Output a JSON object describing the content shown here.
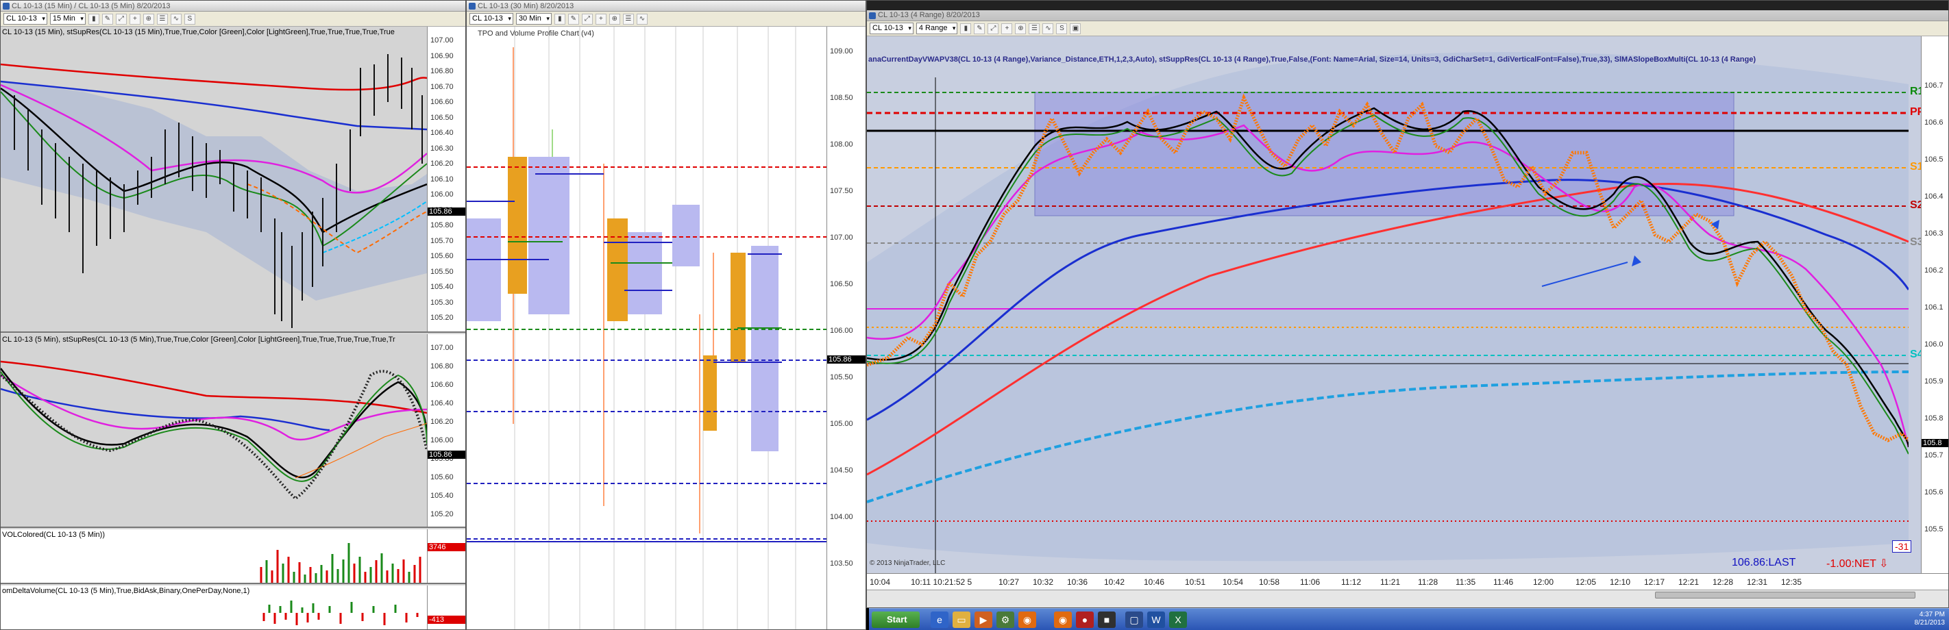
{
  "left_window": {
    "title": "CL 10-13 (15 Min) / CL 10-13 (5 Min)  8/20/2013",
    "instrument": "CL 10-13",
    "interval": "15 Min",
    "panel1_label": "CL 10-13 (15 Min), stSupRes(CL 10-13 (15 Min),True,True,Color [Green],Color [LightGreen],True,True,True,True,True",
    "panel1_ticks": [
      "107.00",
      "106.90",
      "106.80",
      "106.70",
      "106.60",
      "106.50",
      "106.40",
      "106.30",
      "106.20",
      "106.10",
      "106.00",
      "105.90",
      "105.80",
      "105.70",
      "105.60",
      "105.50",
      "105.40",
      "105.30",
      "105.20"
    ],
    "panel1_last": "105.86",
    "panel2_label": "CL 10-13 (5 Min), stSupRes(CL 10-13 (5 Min),True,True,Color [Green],Color [LightGreen],True,True,True,True,True,Tr",
    "panel2_ticks": [
      "107.00",
      "106.80",
      "106.60",
      "106.40",
      "106.20",
      "106.00",
      "105.80",
      "105.60",
      "105.40",
      "105.20"
    ],
    "panel2_last": "105.86",
    "panel3_label": "VOLColored(CL 10-13 (5 Min))",
    "panel3_value": "3746",
    "panel4_label": "omDeltaVolume(CL 10-13 (5 Min),True,BidAsk,Binary,OnePerDay,None,1)",
    "panel4_value": "-413"
  },
  "middle_window": {
    "title": "CL 10-13 (30 Min)  8/20/2013",
    "instrument": "CL 10-13",
    "interval": "30 Min",
    "chart_label": "TPO and Volume Profile Chart (v4)",
    "ticks": [
      "109.00",
      "108.50",
      "108.00",
      "107.50",
      "107.00",
      "106.50",
      "106.00",
      "105.50",
      "105.00",
      "104.50",
      "104.00",
      "103.50"
    ],
    "last": "105.86"
  },
  "right_window": {
    "title": "CL 10-13 (4 Range)  8/20/2013",
    "instrument": "CL 10-13",
    "interval": "4 Range",
    "indicator_text": "anaCurrentDayVWAPV38(CL 10-13 (4 Range),Variance_Distance,ETH,1,2,3,Auto), stSuppRes(CL 10-13 (4 Range),True,False,(Font: Name=Arial, Size=14, Units=3, GdiCharSet=1, GdiVerticalFont=False),True,33), SlMASlopeBoxMulti(CL 10-13 (4 Range)",
    "level_labels": [
      "R1",
      "PP",
      "S1",
      "S2",
      "S3",
      "S4"
    ],
    "ticks": [
      "106.7",
      "106.6",
      "106.5",
      "106.4",
      "106.3",
      "106.2",
      "106.1",
      "106.0",
      "105.9",
      "105.8",
      "105.7",
      "105.6",
      "105.5"
    ],
    "last": "105.8",
    "time_labels": [
      "10:04",
      "10:11 10:21:52 5",
      "10:27",
      "10:32",
      "10:36",
      "10:42",
      "10:46",
      "10:51",
      "10:54",
      "10:58",
      "11:06",
      "11:12",
      "11:21",
      "11:28",
      "11:35",
      "11:46",
      "12:00",
      "12:05",
      "12:10",
      "12:17",
      "12:21",
      "12:28",
      "12:31",
      "12:35"
    ],
    "copyright": "© 2013 NinjaTrader, LLC",
    "last_price_text": "106.86:LAST",
    "net_text": "-1.00:NET ⇩",
    "box_value": "-31"
  },
  "taskbar": {
    "start": "Start",
    "time": "4:37 PM",
    "date": "8/21/2013"
  },
  "colors": {
    "r1": "#0a8a0a",
    "pp": "#e00000",
    "s1": "#ff9900",
    "s2": "#c00000",
    "s3": "#888888",
    "s4": "#00c0c0",
    "vwap": "#1ea0e0",
    "panel_bg": "#c8cfe0",
    "profile": "#b9b9f0"
  }
}
